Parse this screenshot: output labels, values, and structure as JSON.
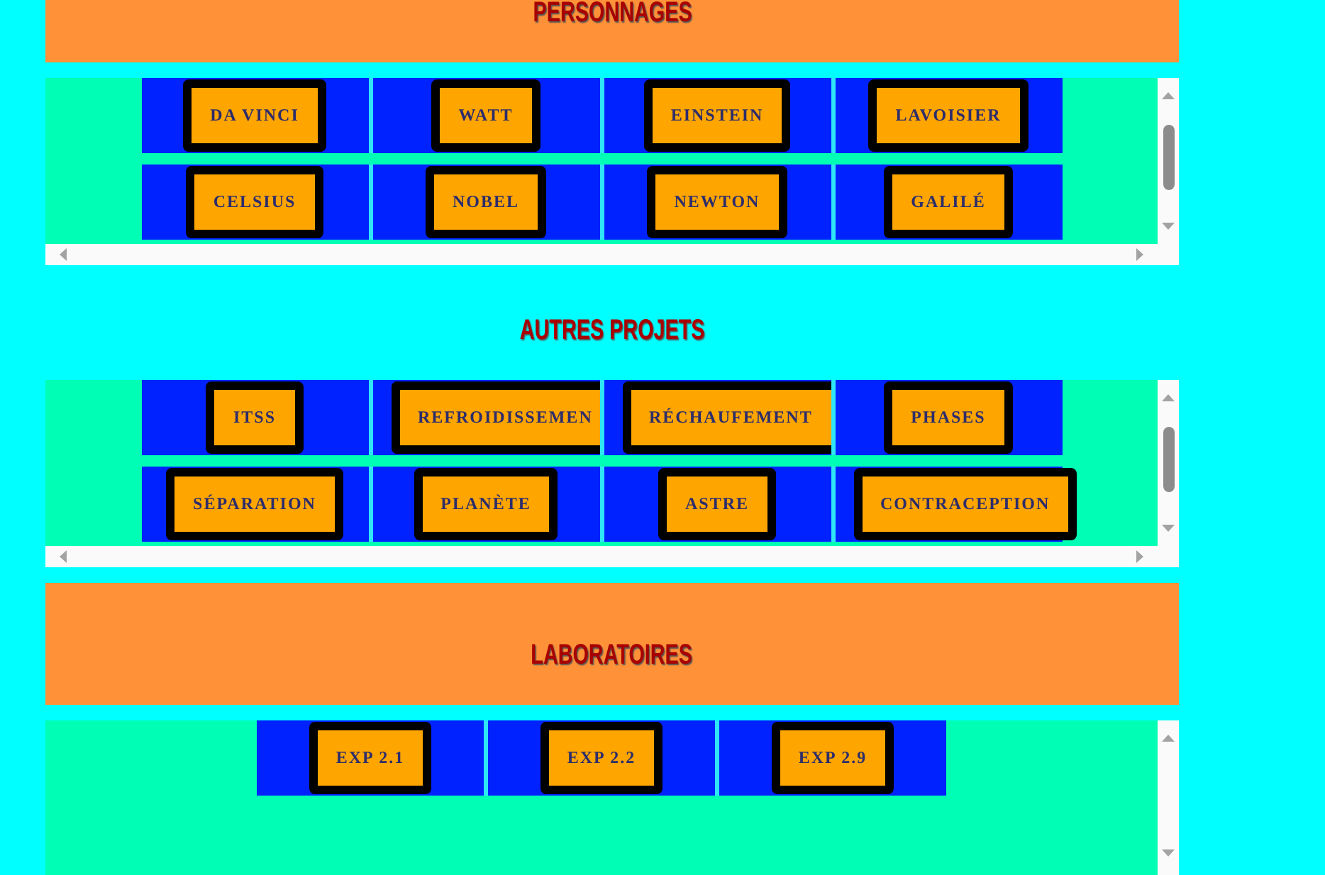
{
  "sections": [
    {
      "title": "PERSONNAGES",
      "kind": "banner",
      "horizontal_scrollbar": true,
      "scroll_thumb": true,
      "rows": [
        {
          "buttons": [
            {
              "label": "DA VINCI",
              "clipped": false
            },
            {
              "label": "WATT",
              "clipped": false
            },
            {
              "label": "EINSTEIN",
              "clipped": false
            },
            {
              "label": "LAVOISIER",
              "clipped": false
            }
          ]
        },
        {
          "buttons": [
            {
              "label": "CELSIUS",
              "clipped": false
            },
            {
              "label": "NOBEL",
              "clipped": false
            },
            {
              "label": "NEWTON",
              "clipped": false
            },
            {
              "label": "GALILÉ",
              "clipped": false
            }
          ]
        }
      ]
    },
    {
      "title": "AUTRES PROJETS",
      "kind": "plain",
      "horizontal_scrollbar": true,
      "scroll_thumb": true,
      "rows": [
        {
          "buttons": [
            {
              "label": "ITSS",
              "clipped": false
            },
            {
              "label": "REFROIDISSEMEN",
              "clipped": true
            },
            {
              "label": "RÉCHAUFEMENT",
              "clipped": true
            },
            {
              "label": "PHASES",
              "clipped": false
            }
          ]
        },
        {
          "buttons": [
            {
              "label": "SÉPARATION",
              "clipped": false
            },
            {
              "label": "PLANÈTE",
              "clipped": false
            },
            {
              "label": "ASTRE",
              "clipped": false
            },
            {
              "label": "CONTRACEPTION",
              "clipped": false
            }
          ]
        }
      ]
    },
    {
      "title": "LABORATOIRES",
      "kind": "banner",
      "horizontal_scrollbar": false,
      "scroll_thumb": false,
      "rows": [
        {
          "buttons": [
            {
              "label": "EXP 2.1",
              "clipped": false
            },
            {
              "label": "EXP 2.2",
              "clipped": false
            },
            {
              "label": "EXP 2.9",
              "clipped": false
            }
          ]
        }
      ]
    }
  ]
}
